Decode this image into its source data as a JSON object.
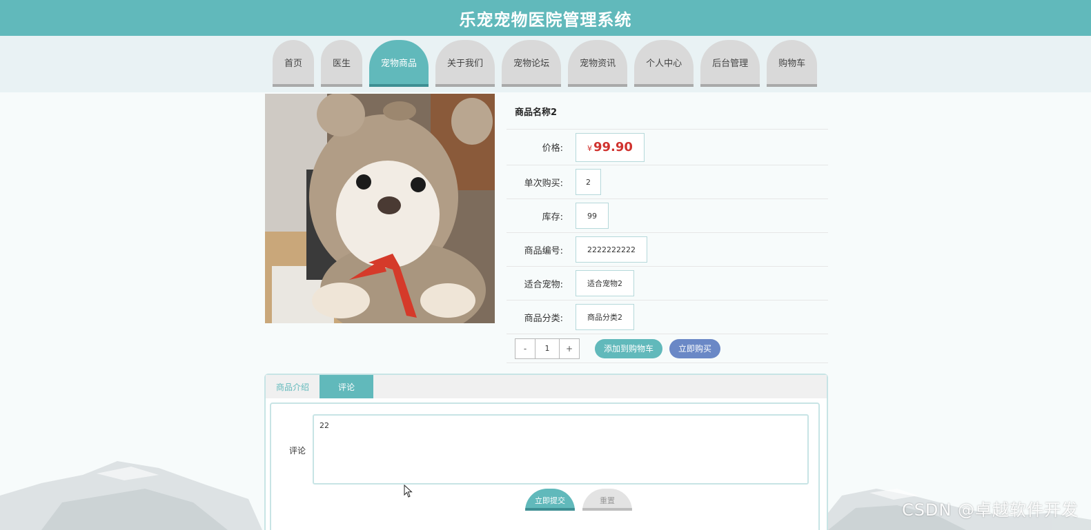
{
  "header": {
    "title": "乐宠宠物医院管理系统"
  },
  "nav": {
    "items": [
      {
        "label": "首页"
      },
      {
        "label": "医生"
      },
      {
        "label": "宠物商品"
      },
      {
        "label": "关于我们"
      },
      {
        "label": "宠物论坛"
      },
      {
        "label": "宠物资讯"
      },
      {
        "label": "个人中心"
      },
      {
        "label": "后台管理"
      },
      {
        "label": "购物车"
      }
    ],
    "active_index": 2
  },
  "product": {
    "name": "商品名称2",
    "price_label": "价格:",
    "price_currency": "¥",
    "price_value": "99.90",
    "single_buy_label": "单次购买:",
    "single_buy_value": "2",
    "stock_label": "库存:",
    "stock_value": "99",
    "code_label": "商品编号:",
    "code_value": "2222222222",
    "pet_label": "适合宠物:",
    "pet_value": "适合宠物2",
    "category_label": "商品分类:",
    "category_value": "商品分类2",
    "image_icon": "dog-in-bear-hoodie-photo"
  },
  "purchase": {
    "minus_label": "-",
    "quantity": "1",
    "plus_label": "+",
    "add_to_cart_label": "添加到购物车",
    "buy_now_label": "立即购买"
  },
  "tabs": {
    "intro_label": "商品介绍",
    "comment_label": "评论"
  },
  "comment_form": {
    "label": "评论",
    "value": "22",
    "submit_label": "立即提交",
    "reset_label": "重置"
  },
  "watermark": "CSDN @卓越软件开发",
  "colors": {
    "primary": "#61b9bb",
    "buy_now": "#6a88c6",
    "price": "#d0322e"
  }
}
